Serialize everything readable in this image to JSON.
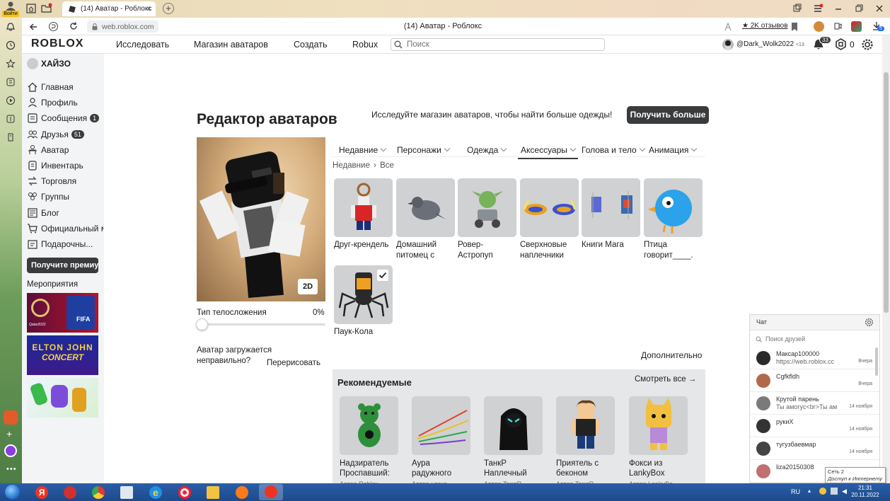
{
  "browser": {
    "login_label": "Войти",
    "tab_title": "(14) Аватар - Роблокс",
    "url": "web.roblox.com",
    "page_title": "(14) Аватар - Роблокс",
    "reviews": "★ 2K отзывов",
    "download_badge": "5"
  },
  "nav": {
    "logo": "ROBLOX",
    "links": [
      "Исследовать",
      "Магазин аватаров",
      "Создать",
      "Robux"
    ],
    "search_placeholder": "Поиск",
    "username": "@Dark_Wolk2022",
    "age_tag": "<13",
    "notifications": "33",
    "robux": "0"
  },
  "sidebar": {
    "user": "ХАЙЗО",
    "items": [
      {
        "label": "Главная",
        "icon": "home-icon",
        "badge": ""
      },
      {
        "label": "Профиль",
        "icon": "profile-icon",
        "badge": ""
      },
      {
        "label": "Сообщения",
        "icon": "messages-icon",
        "badge": "1"
      },
      {
        "label": "Друзья",
        "icon": "friends-icon",
        "badge": "51"
      },
      {
        "label": "Аватар",
        "icon": "avatar-icon",
        "badge": ""
      },
      {
        "label": "Инвентарь",
        "icon": "inventory-icon",
        "badge": ""
      },
      {
        "label": "Торговля",
        "icon": "trade-icon",
        "badge": ""
      },
      {
        "label": "Группы",
        "icon": "groups-icon",
        "badge": ""
      },
      {
        "label": "Блог",
        "icon": "blog-icon",
        "badge": ""
      },
      {
        "label": "Официальный магазин",
        "icon": "shop-icon",
        "badge": ""
      },
      {
        "label": "Подарочны...",
        "icon": "gift-card-icon",
        "badge": ""
      }
    ],
    "premium_button": "Получите премиум",
    "events_title": "Мероприятия",
    "events": [
      {
        "text_1": "FIFA",
        "text_2": "Qatar2022"
      },
      {
        "text_1": "ELTON JOHN",
        "text_2": "CONCERT"
      },
      {
        "text_1": "",
        "text_2": ""
      }
    ]
  },
  "editor": {
    "title": "Редактор аватаров",
    "promo_text": "Исследуйте магазин аватаров, чтобы найти больше одежды!",
    "get_more": "Получить больше",
    "view_2d": "2D",
    "body_type_label": "Тип телосложения",
    "body_type_value": "0%",
    "body_type_fraction": 0.0,
    "problem_text_1": "Аватар загружается",
    "problem_text_2": "неправильно?",
    "redraw": "Перерисовать",
    "tabs": [
      "Недавние",
      "Персонажи",
      "Одежда",
      "Аксессуары",
      "Голова и тело",
      "Анимация"
    ],
    "active_tab": "Аксессуары",
    "breadcrumb": {
      "root": "Недавние",
      "current": "Все"
    },
    "items": [
      {
        "name": "Друг-крендель",
        "icon": "pretzel-friend-icon"
      },
      {
        "name": "Домашний питомец с",
        "icon": "pigeon-pet-icon"
      },
      {
        "name": "Ровер-Астропуп",
        "icon": "astropup-rover-icon"
      },
      {
        "name": "Сверхновые наплечники",
        "icon": "supernova-shoulders-icon"
      },
      {
        "name": "Книги Мага",
        "icon": "mage-books-icon"
      },
      {
        "name": "Птица говорит____.",
        "icon": "blue-bird-icon"
      },
      {
        "name": "Паук-Кола",
        "icon": "spider-cola-icon",
        "selected": true
      }
    ],
    "more_label": "Дополнительно",
    "recommended_title": "Рекомендуемые",
    "see_all": "Смотреть все →",
    "recommended": [
      {
        "name": "Надзиратель Проспавший:",
        "author": "Автор Roblox",
        "icon": "green-bear-icon"
      },
      {
        "name": "Аура радужного",
        "author": "Автор незко",
        "icon": "rainbow-aura-icon"
      },
      {
        "name": "ТанкР Наплечный",
        "author": "Автор TangR",
        "icon": "hooded-figure-icon"
      },
      {
        "name": "Приятель с беконом",
        "author": "Автор TangR",
        "icon": "bacon-friend-icon"
      },
      {
        "name": "Фокси из LankyBox",
        "author": "Автор LankyBo",
        "icon": "foxy-lankybox-icon"
      }
    ]
  },
  "chat": {
    "title": "Чат",
    "search_placeholder": "Поиск друзей",
    "conversations": [
      {
        "name": "Максар100000",
        "message": "https://web.roblox.cc",
        "time": "Вчера"
      },
      {
        "name": "Cgfkfldh",
        "message": "",
        "time": "Вчера"
      },
      {
        "name": "Крутой парень",
        "message": "Ты амогус<br>Ты ам",
        "time": "14 ноября"
      },
      {
        "name": "рукиХ",
        "message": "",
        "time": "14 ноября"
      },
      {
        "name": "тугузбаевмар",
        "message": "",
        "time": "14 ноября"
      },
      {
        "name": "liza20150308",
        "message": "",
        "time": ""
      }
    ],
    "tooltip_line1": "Сеть 2",
    "tooltip_line2": "Доступ к Интернету"
  },
  "taskbar": {
    "lang": "RU",
    "time": "21:31",
    "date": "20.11.2022"
  }
}
